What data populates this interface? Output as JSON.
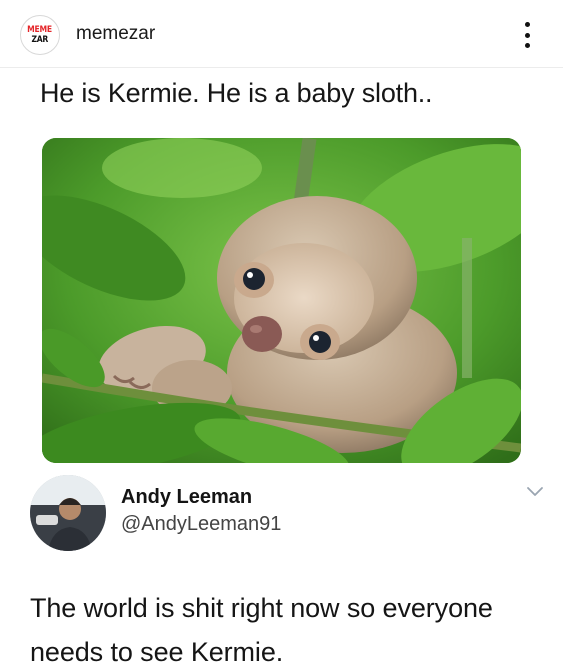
{
  "post": {
    "account": {
      "avatar_line1": "MEME",
      "avatar_line2": "ZAR",
      "username": "memezar"
    },
    "more_icon": "more-vertical-icon",
    "caption": "He is Kermie. He is a baby sloth.."
  },
  "tweet": {
    "name": "Andy Leeman",
    "handle": "@AndyLeeman91",
    "text": "The world is shit right now so everyone needs to see Kermie.",
    "chevron_icon": "chevron-down-icon"
  },
  "colors": {
    "brand_red": "#e4262a",
    "chevron_gray": "#9aa5b1",
    "leaf_green": "#4f9a2a"
  }
}
